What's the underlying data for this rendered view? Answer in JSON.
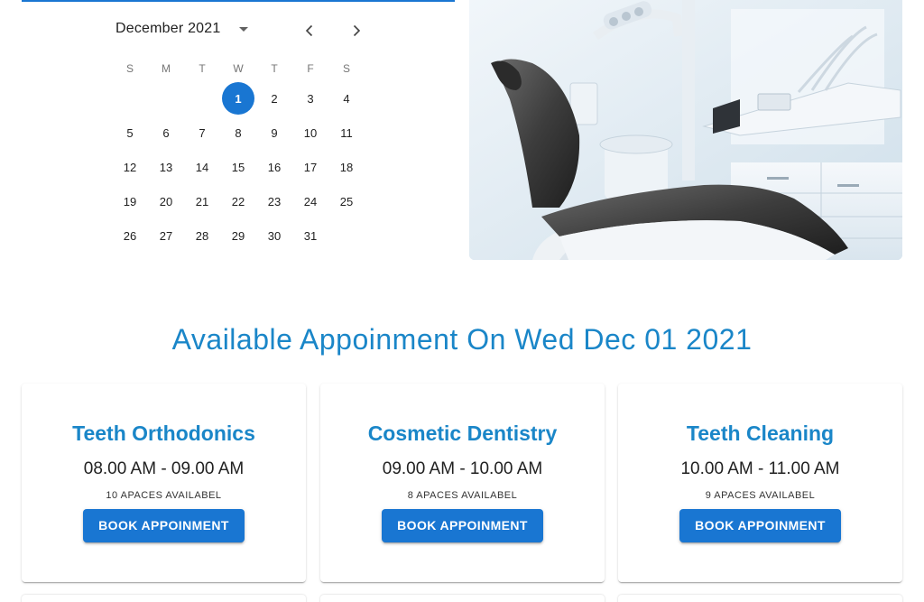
{
  "calendar": {
    "month": "December",
    "year": "2021",
    "weekdays": [
      "S",
      "M",
      "T",
      "W",
      "T",
      "F",
      "S"
    ],
    "weeks": [
      [
        "",
        "",
        "",
        "1",
        "2",
        "3",
        "4"
      ],
      [
        "5",
        "6",
        "7",
        "8",
        "9",
        "10",
        "11"
      ],
      [
        "12",
        "13",
        "14",
        "15",
        "16",
        "17",
        "18"
      ],
      [
        "19",
        "20",
        "21",
        "22",
        "23",
        "24",
        "25"
      ],
      [
        "26",
        "27",
        "28",
        "29",
        "30",
        "31",
        ""
      ]
    ],
    "selected_day": "1",
    "icons": {
      "dropdown": "caret-down-icon",
      "prev": "chevron-left-icon",
      "next": "chevron-right-icon"
    },
    "accent_color": "#1976d2"
  },
  "section": {
    "title": "Available Appoinment On Wed Dec 01 2021"
  },
  "appointments": [
    {
      "title": "Teeth Orthodonics",
      "time": "08.00 AM - 09.00 AM",
      "spaces": "10 APACES AVAILABEL",
      "button_label": "BOOK APPOINMENT"
    },
    {
      "title": "Cosmetic Dentistry",
      "time": "09.00 AM - 10.00 AM",
      "spaces": "8 APACES AVAILABEL",
      "button_label": "BOOK APPOINMENT"
    },
    {
      "title": "Teeth Cleaning",
      "time": "10.00 AM - 11.00 AM",
      "spaces": "9 APACES AVAILABEL",
      "button_label": "BOOK APPOINMENT"
    }
  ],
  "colors": {
    "primary": "#1976d2",
    "heading": "#1a86c8"
  }
}
